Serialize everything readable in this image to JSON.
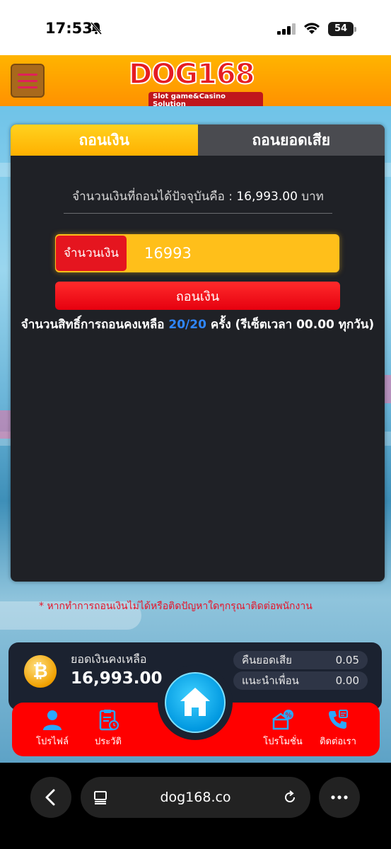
{
  "status": {
    "time": "17:53",
    "battery": "54"
  },
  "header": {
    "logo_text": "DOG168",
    "logo_sub": "Slot game&Casino Solution"
  },
  "tabs": [
    {
      "label": "ถอนเงิน",
      "active": true
    },
    {
      "label": "ถอนยอดเสีย",
      "active": false
    }
  ],
  "withdraw": {
    "current_prefix": "จำนวนเงินที่ถอนได้ปัจจุบันคือ : ",
    "current_value": "16,993.00",
    "current_unit": " บาท",
    "amount_label": "จำนวนเงิน",
    "amount_value": "16993",
    "button_label": "ถอนเงิน",
    "rights_prefix": "จำนวนสิทธิ์การถอนคงเหลือ ",
    "rights_value": "20/20",
    "rights_suffix": " ครั้ง (รีเซ็ตเวลา 00.00 ทุกวัน)"
  },
  "notice": "* หากทำการถอนเงินไม่ได้หรือติดปัญหาใดๆกรุณาติดต่อพนักงาน",
  "balance": {
    "label": "ยอดเงินคงเหลือ",
    "value": "16,993.00",
    "stats": [
      {
        "label": "คืนยอดเสีย",
        "value": "0.05"
      },
      {
        "label": "แนะนำเพื่อน",
        "value": "0.00"
      }
    ]
  },
  "nav": {
    "profile": "โปรไฟล์",
    "history": "ประวัติ",
    "promotion": "โปรโมชั่น",
    "contact": "ติดต่อเรา"
  },
  "browser": {
    "url": "dog168.co"
  },
  "colors": {
    "accent_red": "#ff0000",
    "tab_yellow": "#ffbf1a",
    "rights_blue": "#2f86ff"
  }
}
